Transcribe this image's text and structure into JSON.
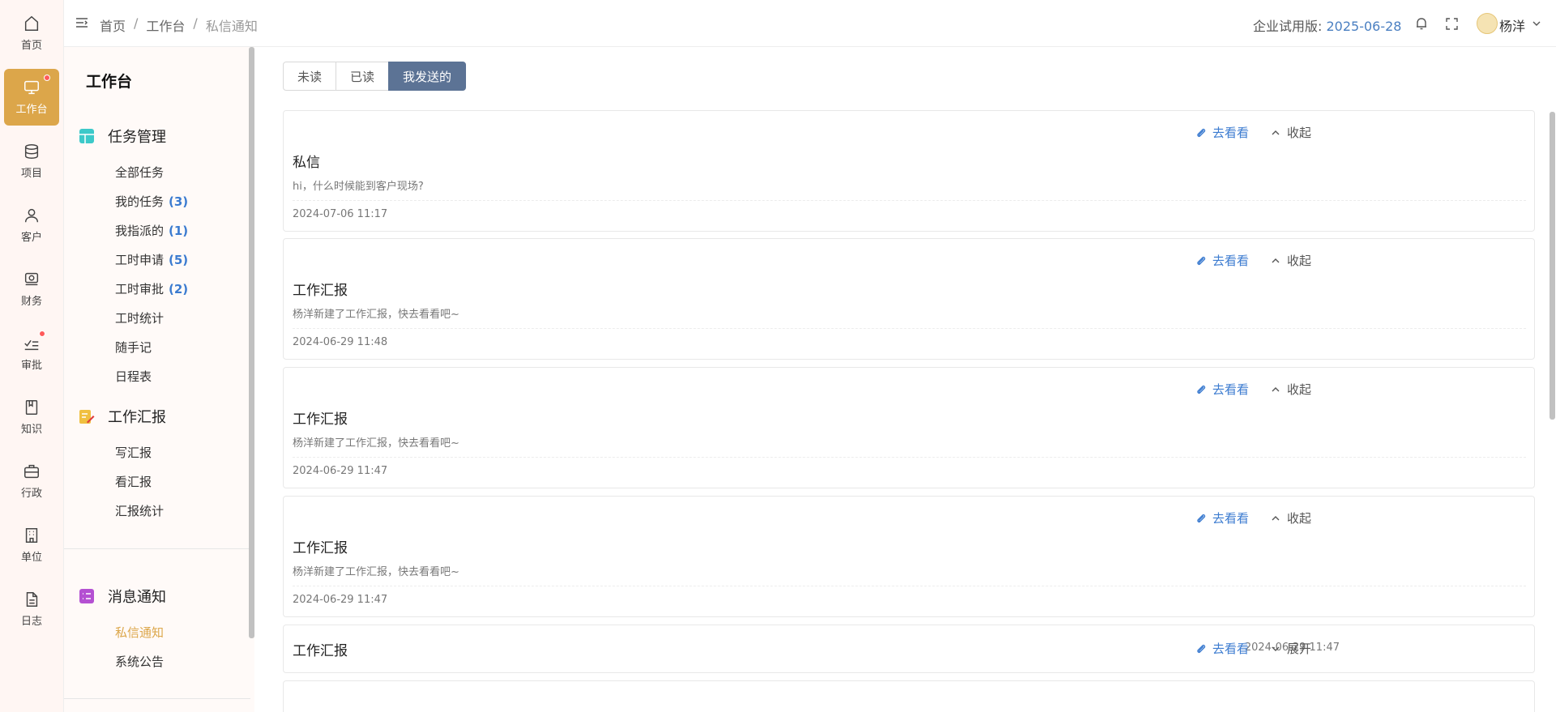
{
  "rail": {
    "items": [
      {
        "label": "首页",
        "icon": "home-icon"
      },
      {
        "label": "工作台",
        "icon": "monitor-icon",
        "active": true,
        "dot": true
      },
      {
        "label": "项目",
        "icon": "database-icon"
      },
      {
        "label": "客户",
        "icon": "user-icon"
      },
      {
        "label": "财务",
        "icon": "money-icon"
      },
      {
        "label": "审批",
        "icon": "checklist-icon",
        "dot": true
      },
      {
        "label": "知识",
        "icon": "book-icon"
      },
      {
        "label": "行政",
        "icon": "briefcase-icon"
      },
      {
        "label": "单位",
        "icon": "building-icon"
      },
      {
        "label": "日志",
        "icon": "file-icon"
      }
    ]
  },
  "topbar": {
    "breadcrumb": [
      "首页",
      "工作台",
      "私信通知"
    ],
    "trial_label": "企业试用版:",
    "trial_date": "2025-06-28",
    "user_name": "杨洋"
  },
  "sidebar": {
    "title": "工作台",
    "sections": [
      {
        "title": "任务管理",
        "color": "#3cc9c9",
        "items": [
          {
            "label": "全部任务",
            "count": ""
          },
          {
            "label": "我的任务",
            "count": "(3)"
          },
          {
            "label": "我指派的",
            "count": "(1)"
          },
          {
            "label": "工时申请",
            "count": "(5)"
          },
          {
            "label": "工时审批",
            "count": "(2)"
          },
          {
            "label": "工时统计",
            "count": ""
          },
          {
            "label": "随手记",
            "count": ""
          },
          {
            "label": "日程表",
            "count": ""
          }
        ]
      },
      {
        "title": "工作汇报",
        "color": "#f0c040",
        "items": [
          {
            "label": "写汇报",
            "count": ""
          },
          {
            "label": "看汇报",
            "count": ""
          },
          {
            "label": "汇报统计",
            "count": ""
          }
        ]
      },
      {
        "title": "消息通知",
        "color": "#b450d2",
        "items": [
          {
            "label": "私信通知",
            "count": "",
            "active": true
          },
          {
            "label": "系统公告",
            "count": ""
          }
        ]
      }
    ]
  },
  "tabs": [
    {
      "label": "未读"
    },
    {
      "label": "已读"
    },
    {
      "label": "我发送的",
      "active": true
    }
  ],
  "messages": [
    {
      "title": "私信",
      "body": "hi，什么时候能到客户现场?",
      "time": "2024-07-06 11:17",
      "go": "去看看",
      "toggle": "收起",
      "expanded": true
    },
    {
      "title": "工作汇报",
      "body": "杨洋新建了工作汇报，快去看看吧~",
      "time": "2024-06-29 11:48",
      "go": "去看看",
      "toggle": "收起",
      "expanded": true
    },
    {
      "title": "工作汇报",
      "body": "杨洋新建了工作汇报，快去看看吧~",
      "time": "2024-06-29 11:47",
      "go": "去看看",
      "toggle": "收起",
      "expanded": true
    },
    {
      "title": "工作汇报",
      "body": "杨洋新建了工作汇报，快去看看吧~",
      "time": "2024-06-29 11:47",
      "go": "去看看",
      "toggle": "收起",
      "expanded": true
    },
    {
      "title": "工作汇报",
      "body": "",
      "time": "2024-06-29 11:47",
      "go": "去看看",
      "toggle": "展开",
      "expanded": false
    }
  ],
  "colors": {
    "accent": "#dca64a",
    "link": "#3b7bd0",
    "tab_active": "#5c7395"
  }
}
